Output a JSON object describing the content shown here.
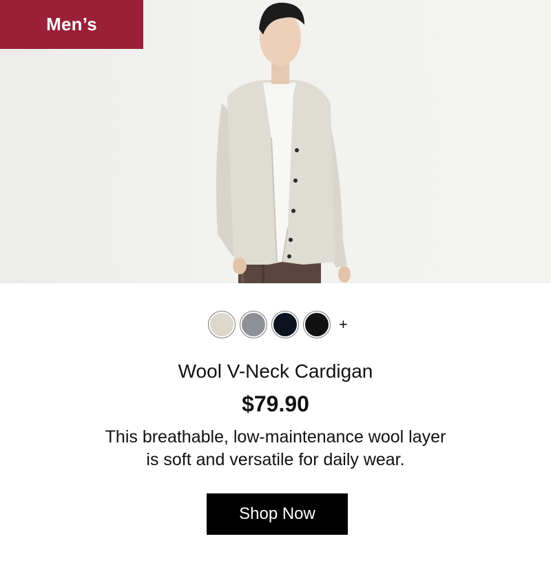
{
  "badge": {
    "label": "Men’s",
    "color": "#9b1f36"
  },
  "hero": {
    "image_icon": "model-in-cardigan-photo"
  },
  "swatches": {
    "items": [
      {
        "name": "oatmeal",
        "color": "#dcd8cc"
      },
      {
        "name": "gray",
        "color": "#8e9096"
      },
      {
        "name": "navy",
        "color": "#0d1220"
      },
      {
        "name": "black",
        "color": "#111111"
      }
    ],
    "more_label": "+"
  },
  "product": {
    "title": "Wool V-Neck Cardigan",
    "price": "$79.90",
    "description_line1": "This breathable, low-maintenance wool layer",
    "description_line2": "is soft and versatile for daily wear."
  },
  "cta": {
    "label": "Shop Now"
  }
}
